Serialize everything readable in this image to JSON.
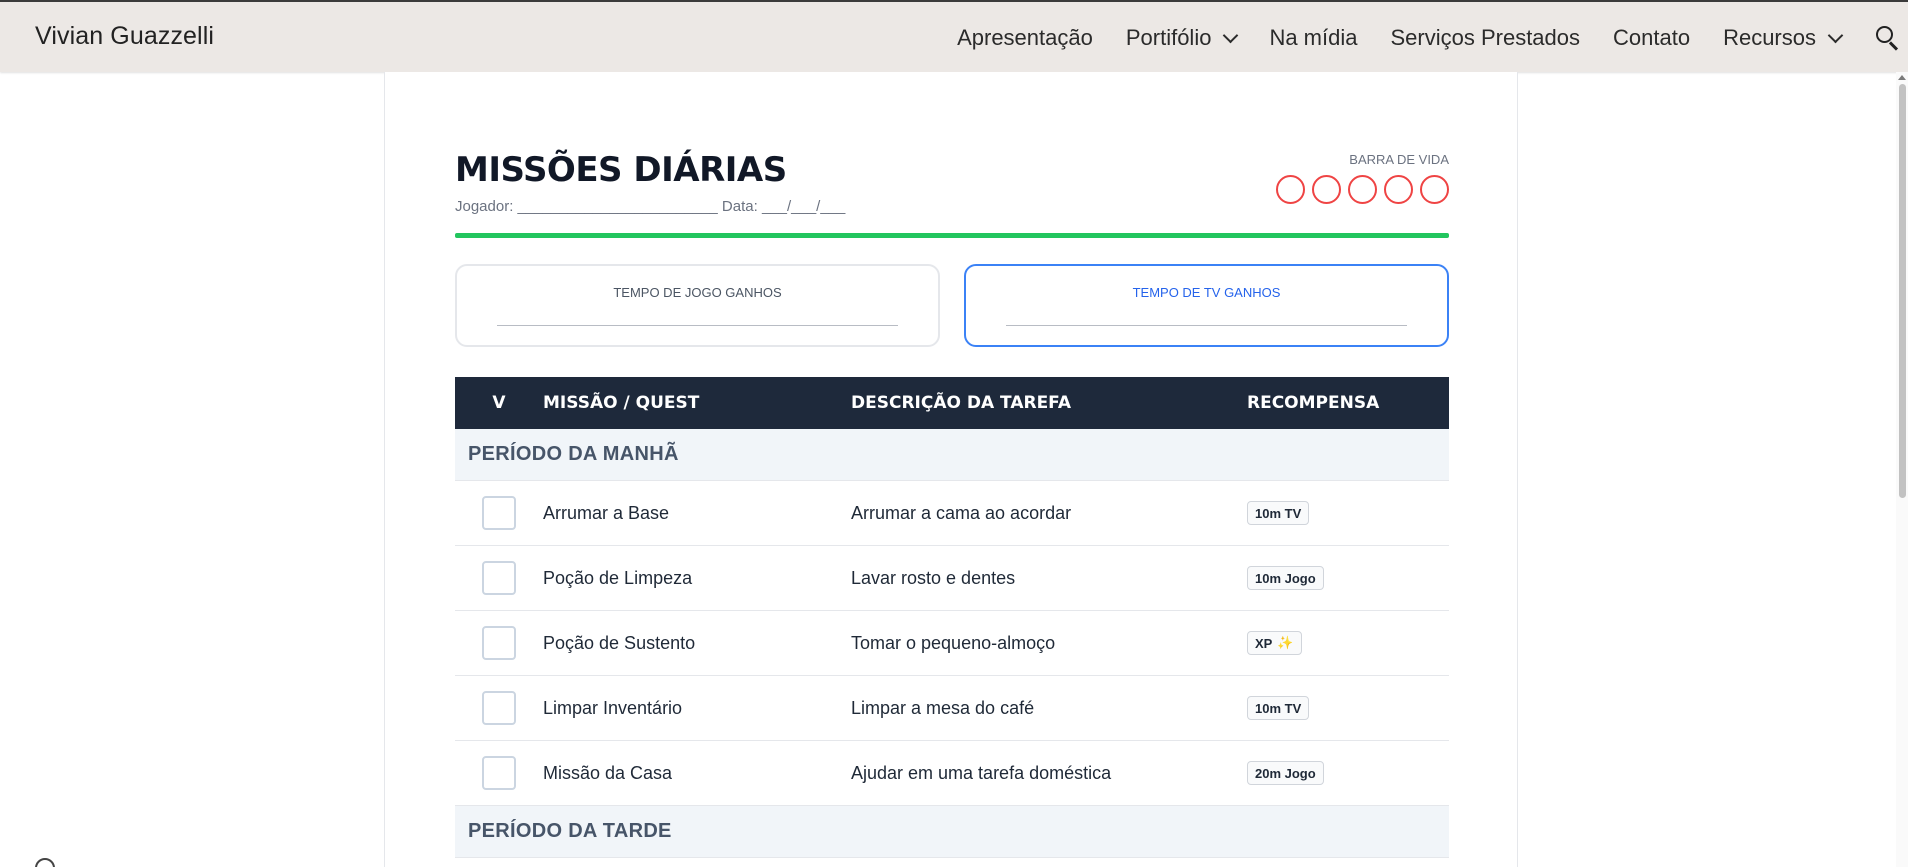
{
  "site": {
    "brand": "Vivian Guazzelli"
  },
  "nav": {
    "items": [
      {
        "label": "Apresentação",
        "dropdown": false
      },
      {
        "label": "Portifólio",
        "dropdown": true
      },
      {
        "label": "Na mídia",
        "dropdown": false
      },
      {
        "label": "Serviços Prestados",
        "dropdown": false
      },
      {
        "label": "Contato",
        "dropdown": false
      },
      {
        "label": "Recursos",
        "dropdown": true
      }
    ],
    "search_icon": "search-icon"
  },
  "sheet": {
    "title": "MISSÕES DIÁRIAS",
    "subline": "Jogador: ________________________  Data: ___/___/___",
    "life_bar": {
      "label": "BARRA DE VIDA",
      "count": 5,
      "color": "#ef4444"
    },
    "accent_line_color": "#22c55e",
    "rewards_boxes": [
      {
        "label": "TEMPO DE JOGO GANHOS"
      },
      {
        "label": "TEMPO DE TV GANHOS",
        "accent": "#3b82f6"
      }
    ],
    "table": {
      "header_bg": "#1e293b",
      "columns": [
        "V",
        "MISSÃO / QUEST",
        "DESCRIÇÃO DA TAREFA",
        "RECOMPENSA"
      ],
      "sections": [
        {
          "title": "PERÍODO DA MANHÃ",
          "rows": [
            {
              "mission": "Arrumar a Base",
              "description": "Arrumar a cama ao acordar",
              "reward": "10m TV",
              "reward_icon": ""
            },
            {
              "mission": "Poção de Limpeza",
              "description": "Lavar rosto e dentes",
              "reward": "10m Jogo",
              "reward_icon": ""
            },
            {
              "mission": "Poção de Sustento",
              "description": "Tomar o pequeno-almoço",
              "reward": "XP",
              "reward_icon": "✨"
            },
            {
              "mission": "Limpar Inventário",
              "description": "Limpar a mesa do café",
              "reward": "10m TV",
              "reward_icon": ""
            },
            {
              "mission": "Missão da Casa",
              "description": "Ajudar em uma tarefa doméstica",
              "reward": "20m Jogo",
              "reward_icon": ""
            }
          ]
        },
        {
          "title": "PERÍODO DA TARDE",
          "rows": []
        }
      ]
    }
  }
}
